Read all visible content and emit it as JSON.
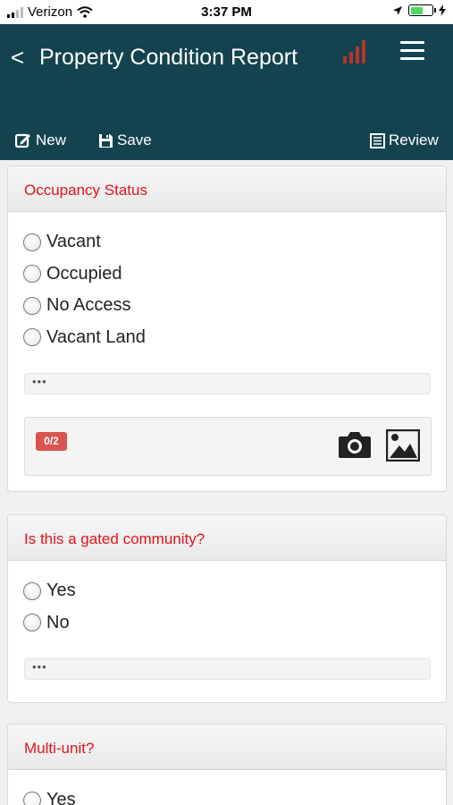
{
  "status_bar": {
    "carrier": "Verizon",
    "time": "3:37 PM"
  },
  "header": {
    "back_label": "<",
    "title": "Property Condition Report",
    "toolbar": {
      "new_label": "New",
      "save_label": "Save",
      "review_label": "Review"
    }
  },
  "sections": [
    {
      "title": "Occupancy Status",
      "options": [
        "Vacant",
        "Occupied",
        "No Access",
        "Vacant Land"
      ],
      "comment_placeholder": "•••",
      "photo_count": "0/2"
    },
    {
      "title": "Is this a gated community?",
      "options": [
        "Yes",
        "No"
      ],
      "comment_placeholder": "•••"
    },
    {
      "title": "Multi-unit?",
      "options": [
        "Yes"
      ]
    }
  ],
  "colors": {
    "header_bg": "#14434f",
    "section_title": "#e0141b",
    "badge": "#d9534f",
    "signal_bars": "#b5362b"
  },
  "icons": [
    "wifi-icon",
    "location-arrow-icon",
    "battery-icon",
    "charging-bolt-icon",
    "back-chevron-icon",
    "signal-strength-icon",
    "hamburger-menu-icon",
    "edit-icon",
    "save-icon",
    "review-icon",
    "camera-icon",
    "image-gallery-icon"
  ]
}
